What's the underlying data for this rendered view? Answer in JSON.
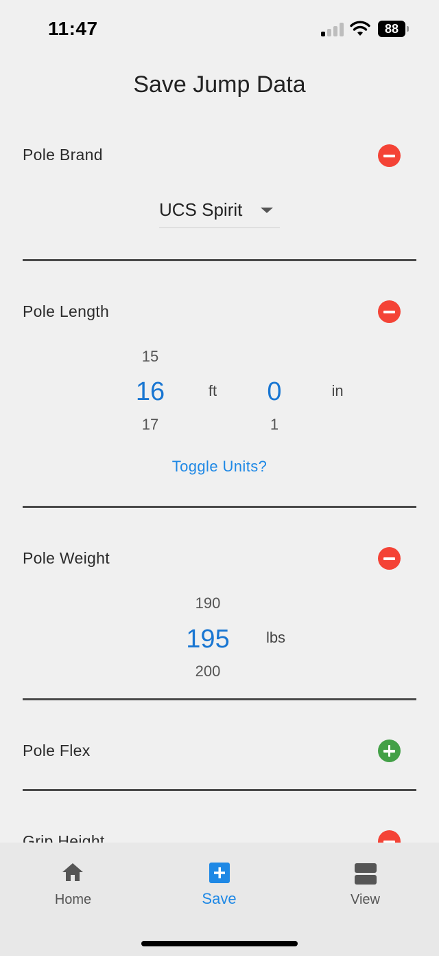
{
  "status_bar": {
    "time": "11:47",
    "battery": "88",
    "signal_bars_active": 1,
    "signal_bars_total": 4
  },
  "page": {
    "title": "Save Jump Data"
  },
  "sections": {
    "pole_brand": {
      "label": "Pole Brand",
      "action_icon": "remove-circle-icon",
      "selected_brand": "UCS Spirit"
    },
    "pole_length": {
      "label": "Pole Length",
      "action_icon": "remove-circle-icon",
      "feet": {
        "prev": "15",
        "selected": "16",
        "next": "17",
        "unit": "ft"
      },
      "inches": {
        "prev": "",
        "selected": "0",
        "next": "1",
        "unit": "in"
      },
      "toggle_label": "Toggle Units?"
    },
    "pole_weight": {
      "label": "Pole Weight",
      "action_icon": "remove-circle-icon",
      "weight": {
        "prev": "190",
        "selected": "195",
        "next": "200",
        "unit": "lbs"
      }
    },
    "pole_flex": {
      "label": "Pole Flex",
      "action_icon": "add-circle-icon"
    },
    "grip_height": {
      "label": "Grip Height",
      "action_icon": "remove-circle-icon"
    }
  },
  "colors": {
    "accent": "#1e88e5",
    "remove": "#f44336",
    "add": "#43a047",
    "background": "#f0f0f0",
    "nav_background": "#e8e8e8"
  },
  "bottom_nav": {
    "items": [
      {
        "label": "Home",
        "icon": "home-icon",
        "active": false
      },
      {
        "label": "Save",
        "icon": "add-box-icon",
        "active": true
      },
      {
        "label": "View",
        "icon": "view-agenda-icon",
        "active": false
      }
    ]
  }
}
